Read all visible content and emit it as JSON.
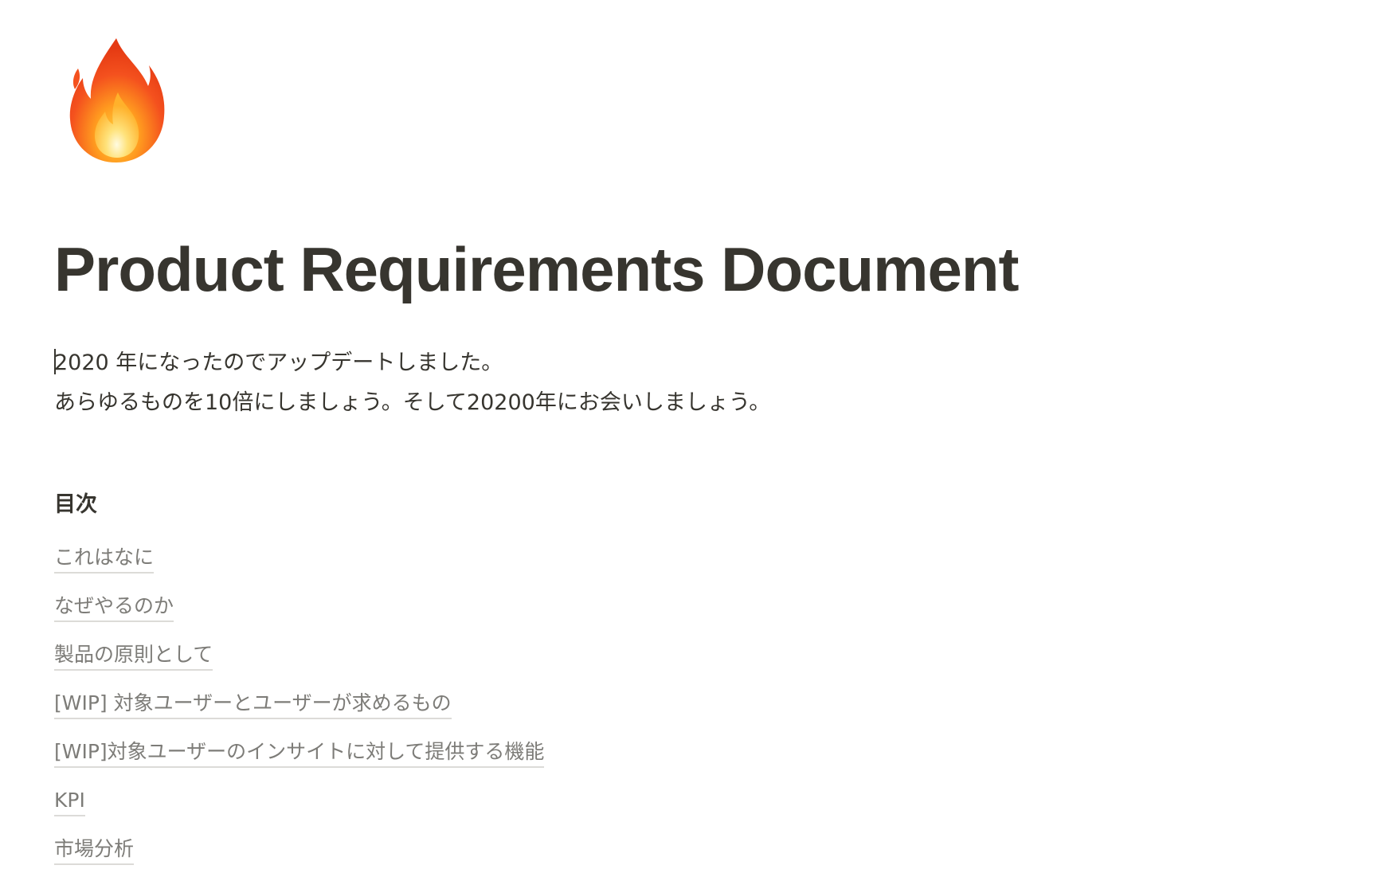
{
  "page": {
    "icon": "fire-emoji-icon",
    "title": "Product Requirements Document",
    "intro_lines": [
      "2020 年になったのでアップデートしました。",
      "あらゆるものを10倍にしましょう。そして20200年にお会いしましょう。"
    ]
  },
  "toc": {
    "heading": "目次",
    "items": [
      {
        "label": "これはなに"
      },
      {
        "label": "なぜやるのか"
      },
      {
        "label": "製品の原則として"
      },
      {
        "label": "[WIP] 対象ユーザーとユーザーが求めるもの"
      },
      {
        "label": "[WIP]対象ユーザーのインサイトに対して提供する機能"
      },
      {
        "label": "KPI"
      },
      {
        "label": "市場分析"
      }
    ]
  },
  "colors": {
    "text": "#37352f",
    "link_text": "#7d7c78",
    "link_underline": "#dcdbd8",
    "background": "#ffffff"
  }
}
